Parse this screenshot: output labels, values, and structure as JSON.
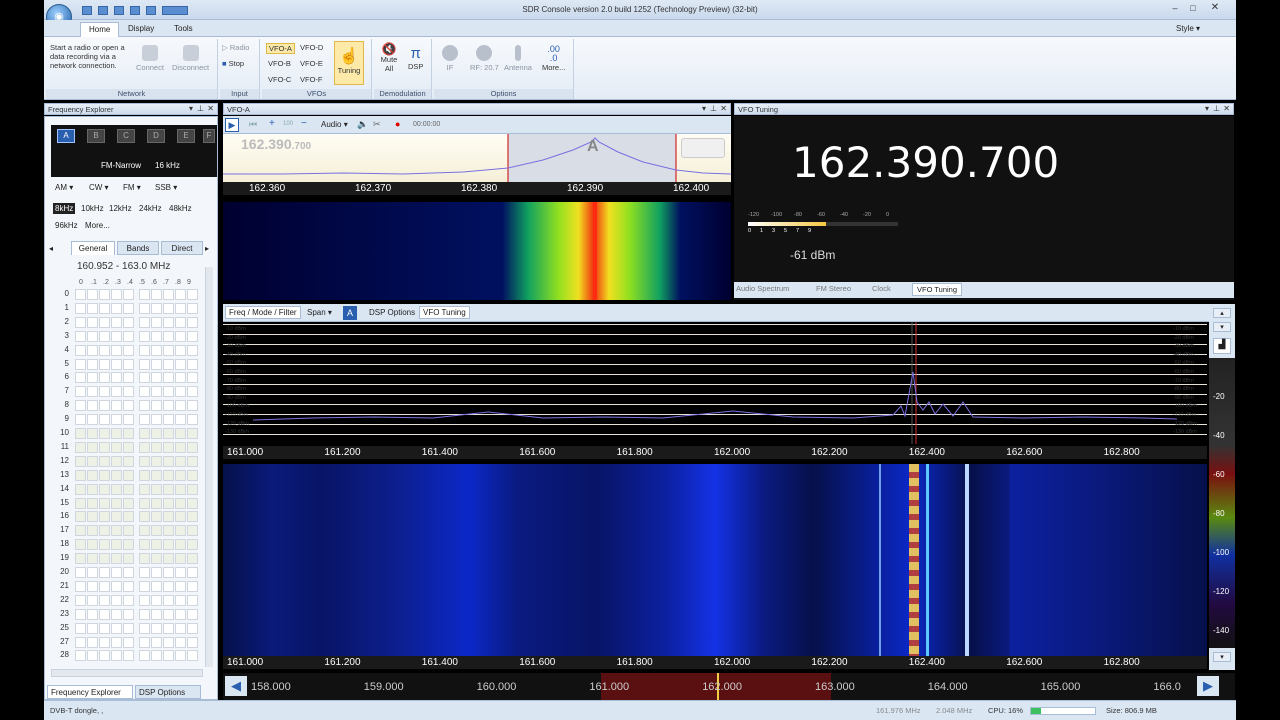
{
  "window": {
    "title": "SDR Console version 2.0 build 1252 (Technology Preview) (32-bit)",
    "style_label": "Style"
  },
  "tabs": [
    "Home",
    "Display",
    "Tools"
  ],
  "ribbon": {
    "network_hint": "Start a radio or open a data recording via a network connection.",
    "connect": "Connect",
    "disconnect": "Disconnect",
    "network_group": "Network",
    "radio": "Radio",
    "stop": "Stop",
    "input_group": "Input",
    "vfos": [
      "VFO-A",
      "VFO-D",
      "VFO-B",
      "VFO-E",
      "VFO-C",
      "VFO-F"
    ],
    "vfos_group": "VFOs",
    "tuning": "Tuning",
    "mute_all": "Mute All",
    "dsp": "DSP",
    "demod_group": "Demodulation",
    "if": "IF",
    "rf": "RF: 20.7",
    "antenna": "Antenna",
    "more": "More...",
    "options_group": "Options",
    "more_glyph": ".00\n.0"
  },
  "freq_explorer": {
    "title": "Frequency Explorer",
    "selectors": [
      "A",
      "B",
      "C",
      "D",
      "E",
      "F"
    ],
    "mode_line": "FM-Narrow",
    "bw_line": "16 kHz",
    "modes": [
      "AM",
      "CW",
      "FM",
      "SSB"
    ],
    "bandwidths": [
      "8kHz",
      "10kHz",
      "12kHz",
      "24kHz",
      "48kHz",
      "96kHz",
      "More..."
    ],
    "tabs": [
      "General",
      "Bands",
      "Direct"
    ],
    "range": "160.952 - 163.0 MHz",
    "col_headers": [
      "0",
      ".1",
      ".2",
      ".3",
      ".4",
      ".5",
      ".6",
      ".7",
      ".8",
      "9"
    ],
    "rows": [
      "0",
      "1",
      "2",
      "3",
      "4",
      "5",
      "6",
      "7",
      "8",
      "9",
      "10",
      "11",
      "12",
      "13",
      "14",
      "15",
      "16",
      "17",
      "18",
      "19",
      "20",
      "21",
      "22",
      "23",
      "25",
      "27",
      "28"
    ],
    "bottom_tabs": [
      "Frequency Explorer",
      "DSP Options"
    ]
  },
  "vfo_a": {
    "title": "VFO-A",
    "audio": "Audio",
    "timer": "00:00:00",
    "freq_overlay": "162.390",
    "freq_overlay_small": ".700",
    "marker": "A",
    "axis": [
      "162.360",
      "162.370",
      "162.380",
      "162.390",
      "162.400"
    ],
    "zoom_label": "100"
  },
  "vfo_tuning": {
    "title": "VFO Tuning",
    "frequency": "162.390.700",
    "level": "-61 dBm",
    "meter_top": [
      "-120",
      "-100",
      "-80",
      "-60",
      "-40",
      "-20",
      "0"
    ],
    "meter_bottom": [
      "0",
      "1",
      "3",
      "5",
      "7",
      "9"
    ],
    "tabs": [
      "Audio Spectrum",
      "FM Stereo",
      "Clock",
      "VFO Tuning"
    ]
  },
  "main": {
    "toolbar": [
      "Freq / Mode / Filter",
      "Span",
      "A",
      "DSP Options",
      "VFO Tuning"
    ],
    "dbm_labels": [
      "-10 dBm",
      "-20 dBm",
      "-30 dBm",
      "-40 dBm",
      "-50 dBm",
      "-60 dBm",
      "-70 dBm",
      "-80 dBm",
      "-90 dBm",
      "-100 dBm",
      "-110 dBm",
      "-120 dBm",
      "-130 dBm"
    ],
    "axis": [
      "161.000",
      "161.200",
      "161.400",
      "161.600",
      "161.800",
      "162.000",
      "162.200",
      "162.400",
      "162.600",
      "162.800"
    ],
    "scale": [
      "-20",
      "-40",
      "-60",
      "-80",
      "-100",
      "-120",
      "-140"
    ]
  },
  "freqbar": {
    "labels": [
      "158.000",
      "159.000",
      "160.000",
      "161.000",
      "162.000",
      "163.000",
      "164.000",
      "165.000",
      "166.0"
    ]
  },
  "status": {
    "device": "DVB-T dongle, ,",
    "freq": "161.976 MHz",
    "rate": "2.048 MHz",
    "cpu": "CPU: 16%",
    "size": "Size: 806.9 MB"
  },
  "colors": {
    "accent": "#2a5fb0",
    "trace": "#7a6fe0",
    "ribbon_bg": "#e4ecf6"
  }
}
